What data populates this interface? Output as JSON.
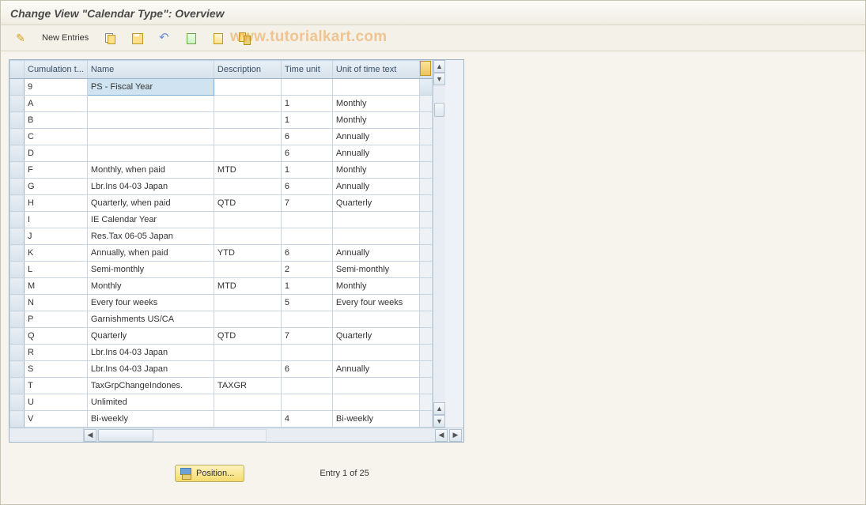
{
  "title": "Change View \"Calendar Type\": Overview",
  "watermark": "www.tutorialkart.com",
  "toolbar": {
    "new_entries_label": "New Entries"
  },
  "columns": {
    "cumulation": "Cumulation t...",
    "name": "Name",
    "description": "Description",
    "time_unit": "Time unit",
    "unit_text": "Unit of time text"
  },
  "rows": [
    {
      "cum": "9",
      "name": "PS - Fiscal Year",
      "desc": "",
      "time": "",
      "unit": "",
      "selected": true
    },
    {
      "cum": "A",
      "name": "",
      "desc": "",
      "time": "1",
      "unit": "Monthly"
    },
    {
      "cum": "B",
      "name": "",
      "desc": "",
      "time": "1",
      "unit": "Monthly"
    },
    {
      "cum": "C",
      "name": "",
      "desc": "",
      "time": "6",
      "unit": "Annually"
    },
    {
      "cum": "D",
      "name": "",
      "desc": "",
      "time": "6",
      "unit": "Annually"
    },
    {
      "cum": "F",
      "name": "Monthly, when paid",
      "desc": "MTD",
      "time": "1",
      "unit": "Monthly"
    },
    {
      "cum": "G",
      "name": "Lbr.Ins 04-03  Japan",
      "desc": "",
      "time": "6",
      "unit": "Annually"
    },
    {
      "cum": "H",
      "name": "Quarterly, when paid",
      "desc": "QTD",
      "time": "7",
      "unit": "Quarterly"
    },
    {
      "cum": "I",
      "name": "IE Calendar Year",
      "desc": "",
      "time": "",
      "unit": ""
    },
    {
      "cum": "J",
      "name": "Res.Tax 06-05  Japan",
      "desc": "",
      "time": "",
      "unit": ""
    },
    {
      "cum": "K",
      "name": "Annually, when paid",
      "desc": "YTD",
      "time": "6",
      "unit": "Annually"
    },
    {
      "cum": "L",
      "name": "Semi-monthly",
      "desc": "",
      "time": "2",
      "unit": "Semi-monthly"
    },
    {
      "cum": "M",
      "name": "Monthly",
      "desc": "MTD",
      "time": "1",
      "unit": "Monthly"
    },
    {
      "cum": "N",
      "name": "Every four weeks",
      "desc": "",
      "time": "5",
      "unit": "Every four weeks"
    },
    {
      "cum": "P",
      "name": "Garnishments US/CA",
      "desc": "",
      "time": "",
      "unit": ""
    },
    {
      "cum": "Q",
      "name": "Quarterly",
      "desc": "QTD",
      "time": "7",
      "unit": "Quarterly"
    },
    {
      "cum": "R",
      "name": "Lbr.Ins 04-03  Japan",
      "desc": "",
      "time": "",
      "unit": ""
    },
    {
      "cum": "S",
      "name": "Lbr.Ins 04-03  Japan",
      "desc": "",
      "time": "6",
      "unit": "Annually"
    },
    {
      "cum": "T",
      "name": "TaxGrpChangeIndones.",
      "desc": "TAXGR",
      "time": "",
      "unit": ""
    },
    {
      "cum": "U",
      "name": "Unlimited",
      "desc": "",
      "time": "",
      "unit": ""
    },
    {
      "cum": "V",
      "name": "Bi-weekly",
      "desc": "",
      "time": "4",
      "unit": "Bi-weekly"
    }
  ],
  "footer": {
    "position_label": "Position...",
    "entry_label": "Entry 1 of 25"
  }
}
